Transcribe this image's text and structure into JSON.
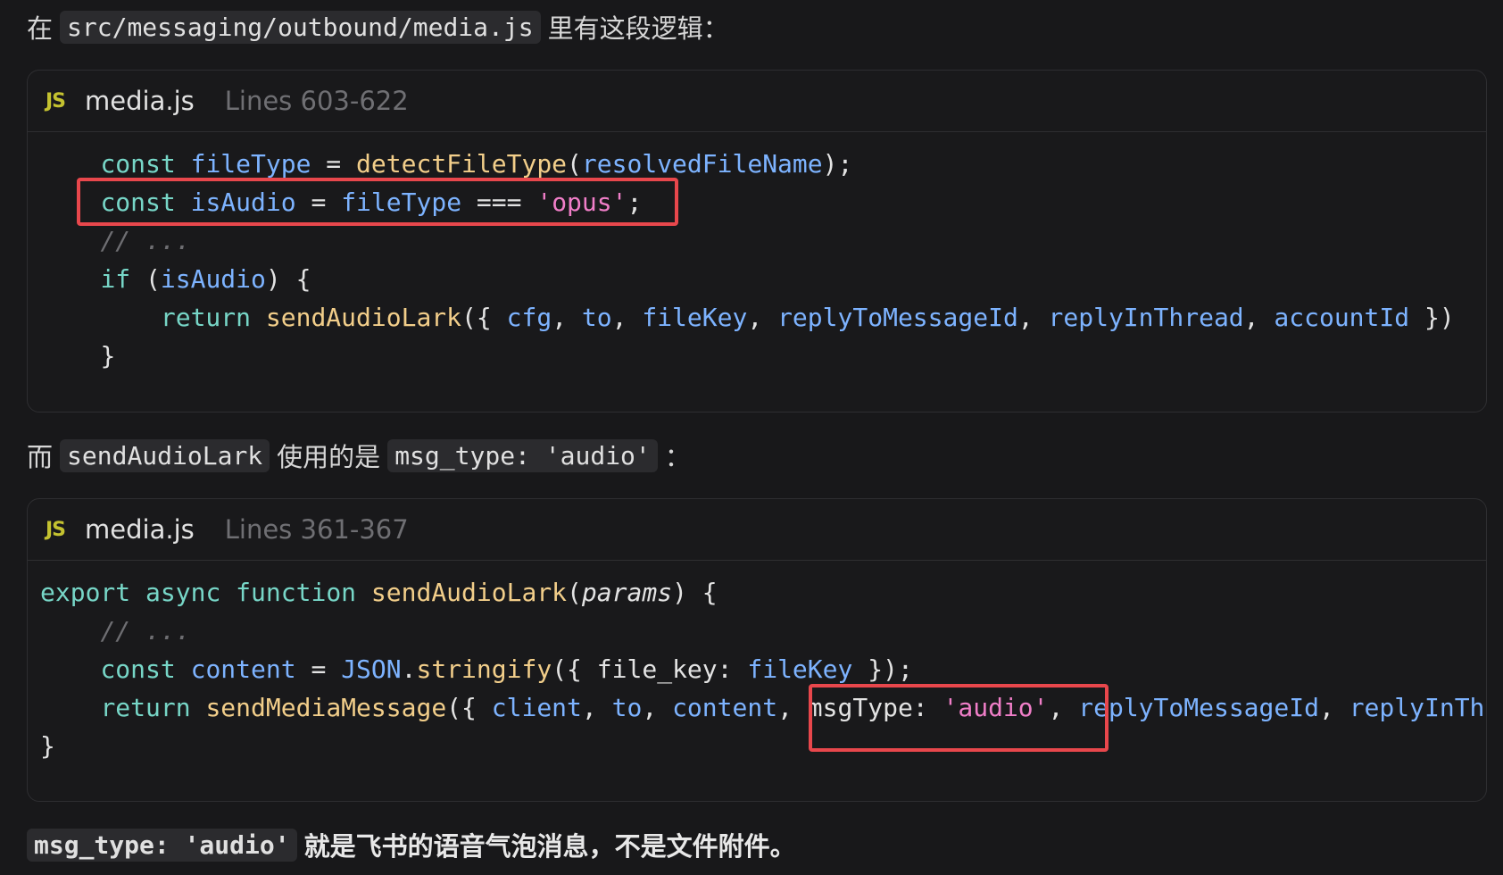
{
  "intro_paragraph": {
    "prefix": "在",
    "path": "src/messaging/outbound/media.js",
    "suffix": "里有这段逻辑："
  },
  "code_block_1": {
    "language_badge": "JS",
    "file_name": "media.js",
    "line_range": "Lines 603-622",
    "lines": [
      {
        "tokens": [
          {
            "t": "    ",
            "c": "plain"
          },
          {
            "t": "const",
            "c": "kw"
          },
          {
            "t": " ",
            "c": "plain"
          },
          {
            "t": "fileType",
            "c": "var"
          },
          {
            "t": " = ",
            "c": "plain"
          },
          {
            "t": "detectFileType",
            "c": "fn"
          },
          {
            "t": "(",
            "c": "plain"
          },
          {
            "t": "resolvedFileName",
            "c": "var"
          },
          {
            "t": ");",
            "c": "plain"
          }
        ]
      },
      {
        "tokens": [
          {
            "t": "    ",
            "c": "plain"
          },
          {
            "t": "const",
            "c": "kw"
          },
          {
            "t": " ",
            "c": "plain"
          },
          {
            "t": "isAudio",
            "c": "var"
          },
          {
            "t": " = ",
            "c": "plain"
          },
          {
            "t": "fileType",
            "c": "var"
          },
          {
            "t": " === ",
            "c": "plain"
          },
          {
            "t": "'opus'",
            "c": "str"
          },
          {
            "t": ";",
            "c": "plain"
          }
        ]
      },
      {
        "tokens": [
          {
            "t": "    ",
            "c": "plain"
          },
          {
            "t": "// ...",
            "c": "cm"
          }
        ]
      },
      {
        "tokens": [
          {
            "t": "    ",
            "c": "plain"
          },
          {
            "t": "if",
            "c": "kw"
          },
          {
            "t": " (",
            "c": "plain"
          },
          {
            "t": "isAudio",
            "c": "var"
          },
          {
            "t": ") {",
            "c": "plain"
          }
        ]
      },
      {
        "tokens": [
          {
            "t": "        ",
            "c": "plain"
          },
          {
            "t": "return",
            "c": "kw"
          },
          {
            "t": " ",
            "c": "plain"
          },
          {
            "t": "sendAudioLark",
            "c": "fn"
          },
          {
            "t": "({ ",
            "c": "plain"
          },
          {
            "t": "cfg",
            "c": "var"
          },
          {
            "t": ", ",
            "c": "plain"
          },
          {
            "t": "to",
            "c": "var"
          },
          {
            "t": ", ",
            "c": "plain"
          },
          {
            "t": "fileKey",
            "c": "var"
          },
          {
            "t": ", ",
            "c": "plain"
          },
          {
            "t": "replyToMessageId",
            "c": "var"
          },
          {
            "t": ", ",
            "c": "plain"
          },
          {
            "t": "replyInThread",
            "c": "var"
          },
          {
            "t": ", ",
            "c": "plain"
          },
          {
            "t": "accountId",
            "c": "var"
          },
          {
            "t": " })",
            "c": "plain"
          }
        ]
      },
      {
        "tokens": [
          {
            "t": "    ",
            "c": "plain"
          },
          {
            "t": "}",
            "c": "plain"
          }
        ]
      }
    ]
  },
  "middle_paragraph": {
    "prefix": "而",
    "function_name": "sendAudioLark",
    "middle": "使用的是",
    "msg_type_code": "msg_type: 'audio'",
    "suffix": "："
  },
  "code_block_2": {
    "language_badge": "JS",
    "file_name": "media.js",
    "line_range": "Lines 361-367",
    "lines": [
      {
        "tokens": [
          {
            "t": "export",
            "c": "kw"
          },
          {
            "t": " ",
            "c": "plain"
          },
          {
            "t": "async",
            "c": "kw"
          },
          {
            "t": " ",
            "c": "plain"
          },
          {
            "t": "function",
            "c": "kw"
          },
          {
            "t": " ",
            "c": "plain"
          },
          {
            "t": "sendAudioLark",
            "c": "fn"
          },
          {
            "t": "(",
            "c": "plain"
          },
          {
            "t": "params",
            "c": "param"
          },
          {
            "t": ") {",
            "c": "plain"
          }
        ]
      },
      {
        "tokens": [
          {
            "t": "    ",
            "c": "plain"
          },
          {
            "t": "// ...",
            "c": "cm"
          }
        ]
      },
      {
        "tokens": [
          {
            "t": "    ",
            "c": "plain"
          },
          {
            "t": "const",
            "c": "kw"
          },
          {
            "t": " ",
            "c": "plain"
          },
          {
            "t": "content",
            "c": "var"
          },
          {
            "t": " = ",
            "c": "plain"
          },
          {
            "t": "JSON",
            "c": "cls"
          },
          {
            "t": ".",
            "c": "plain"
          },
          {
            "t": "stringify",
            "c": "fn"
          },
          {
            "t": "({ ",
            "c": "plain"
          },
          {
            "t": "file_key: ",
            "c": "plain"
          },
          {
            "t": "fileKey",
            "c": "var"
          },
          {
            "t": " });",
            "c": "plain"
          }
        ]
      },
      {
        "tokens": [
          {
            "t": "    ",
            "c": "plain"
          },
          {
            "t": "return",
            "c": "kw"
          },
          {
            "t": " ",
            "c": "plain"
          },
          {
            "t": "sendMediaMessage",
            "c": "fn"
          },
          {
            "t": "({ ",
            "c": "plain"
          },
          {
            "t": "client",
            "c": "var"
          },
          {
            "t": ", ",
            "c": "plain"
          },
          {
            "t": "to",
            "c": "var"
          },
          {
            "t": ", ",
            "c": "plain"
          },
          {
            "t": "content",
            "c": "var"
          },
          {
            "t": ", ",
            "c": "plain"
          },
          {
            "t": "msgType: ",
            "c": "plain"
          },
          {
            "t": "'audio'",
            "c": "str"
          },
          {
            "t": ", ",
            "c": "plain"
          },
          {
            "t": "replyToMessageId",
            "c": "var"
          },
          {
            "t": ", ",
            "c": "plain"
          },
          {
            "t": "replyInThread",
            "c": "var"
          }
        ]
      },
      {
        "tokens": [
          {
            "t": "}",
            "c": "plain"
          }
        ]
      }
    ]
  },
  "conclusion_paragraph": {
    "code": "msg_type: 'audio'",
    "text": "就是飞书的语音气泡消息，不是文件附件。"
  },
  "colors": {
    "background": "#18181a",
    "highlight_border": "#e8474c",
    "keyword": "#77d6c7",
    "function": "#f2ce8a",
    "variable": "#7db3ff",
    "string": "#f07ec8",
    "comment": "#6e6e72",
    "js_badge": "#c4c230"
  }
}
